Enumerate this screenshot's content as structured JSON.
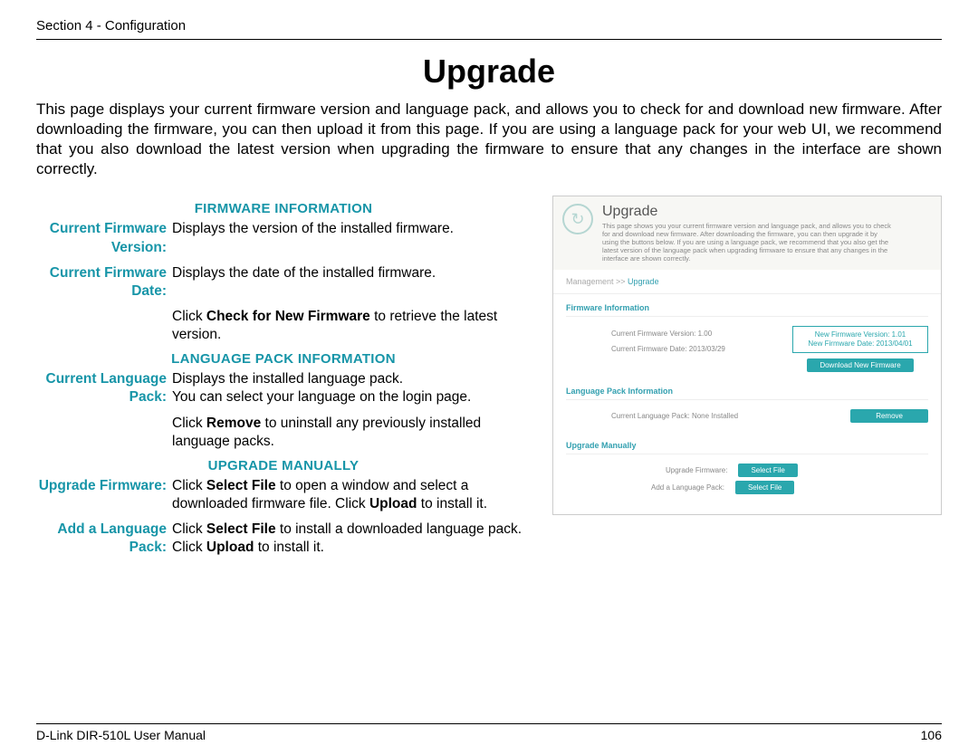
{
  "header": {
    "section": "Section 4 - Configuration"
  },
  "title": "Upgrade",
  "intro": "This page displays your current firmware version and language pack, and allows you to check for and download new firmware. After downloading the firmware, you can then upload it from this page. If you are using a language pack for your web UI, we recommend that you also download the latest version when upgrading the firmware to ensure that any changes in the interface are shown correctly.",
  "sections": {
    "firmware": {
      "heading": "FIRMWARE INFORMATION",
      "rows": [
        {
          "label": "Current Firmware Version:",
          "value": "Displays the version of the installed firmware."
        },
        {
          "label": "Current Firmware Date:",
          "value": "Displays the date of the installed firmware."
        },
        {
          "label": "",
          "value_pre": "Click ",
          "value_bold": "Check for New Firmware",
          "value_post": " to retrieve the latest version."
        }
      ]
    },
    "language": {
      "heading": "LANGUAGE PACK INFORMATION",
      "rows": [
        {
          "label": "Current Language Pack:",
          "value": "Displays the installed language pack.\nYou can select your language on the login page."
        },
        {
          "label": "",
          "value_pre": "Click ",
          "value_bold": "Remove",
          "value_post": " to uninstall any previously installed language packs."
        }
      ]
    },
    "manual": {
      "heading": "UPGRADE MANUALLY",
      "rows": [
        {
          "label": "Upgrade Firmware:",
          "value_pre": "Click ",
          "value_bold": "Select File",
          "value_mid": " to open a window and select a downloaded firmware file. Click ",
          "value_bold2": "Upload",
          "value_post": " to install it."
        },
        {
          "label": "Add a Language Pack:",
          "value_pre": "Click ",
          "value_bold": "Select File",
          "value_mid": " to install a downloaded language pack. Click ",
          "value_bold2": "Upload",
          "value_post": " to install it."
        }
      ]
    }
  },
  "screenshot": {
    "title": "Upgrade",
    "desc": "This page shows you your current firmware version and language pack, and allows you to check for and download new firmware. After downloading the firmware, you can then upgrade it by using the buttons below. If you are using a language pack, we recommend that you also get the latest version of the language pack when upgrading firmware to ensure that any changes in the interface are shown correctly.",
    "breadcrumb_pre": "Management >> ",
    "breadcrumb_cur": "Upgrade",
    "firmware": {
      "title": "Firmware Information",
      "version_label": "Current Firmware Version: 1.00",
      "date_label": "Current Firmware Date: 2013/03/29",
      "box_line1": "New Firmware Version: 1.01",
      "box_line2": "New Firmware Date: 2013/04/01",
      "button": "Download New Firmware"
    },
    "langpack": {
      "title": "Language Pack Information",
      "current": "Current Language Pack: None Installed",
      "button": "Remove"
    },
    "manual": {
      "title": "Upgrade Manually",
      "row1_label": "Upgrade Firmware:",
      "row2_label": "Add a Language Pack:",
      "button": "Select File"
    }
  },
  "footer": {
    "left": "D-Link DIR-510L User Manual",
    "right": "106"
  }
}
